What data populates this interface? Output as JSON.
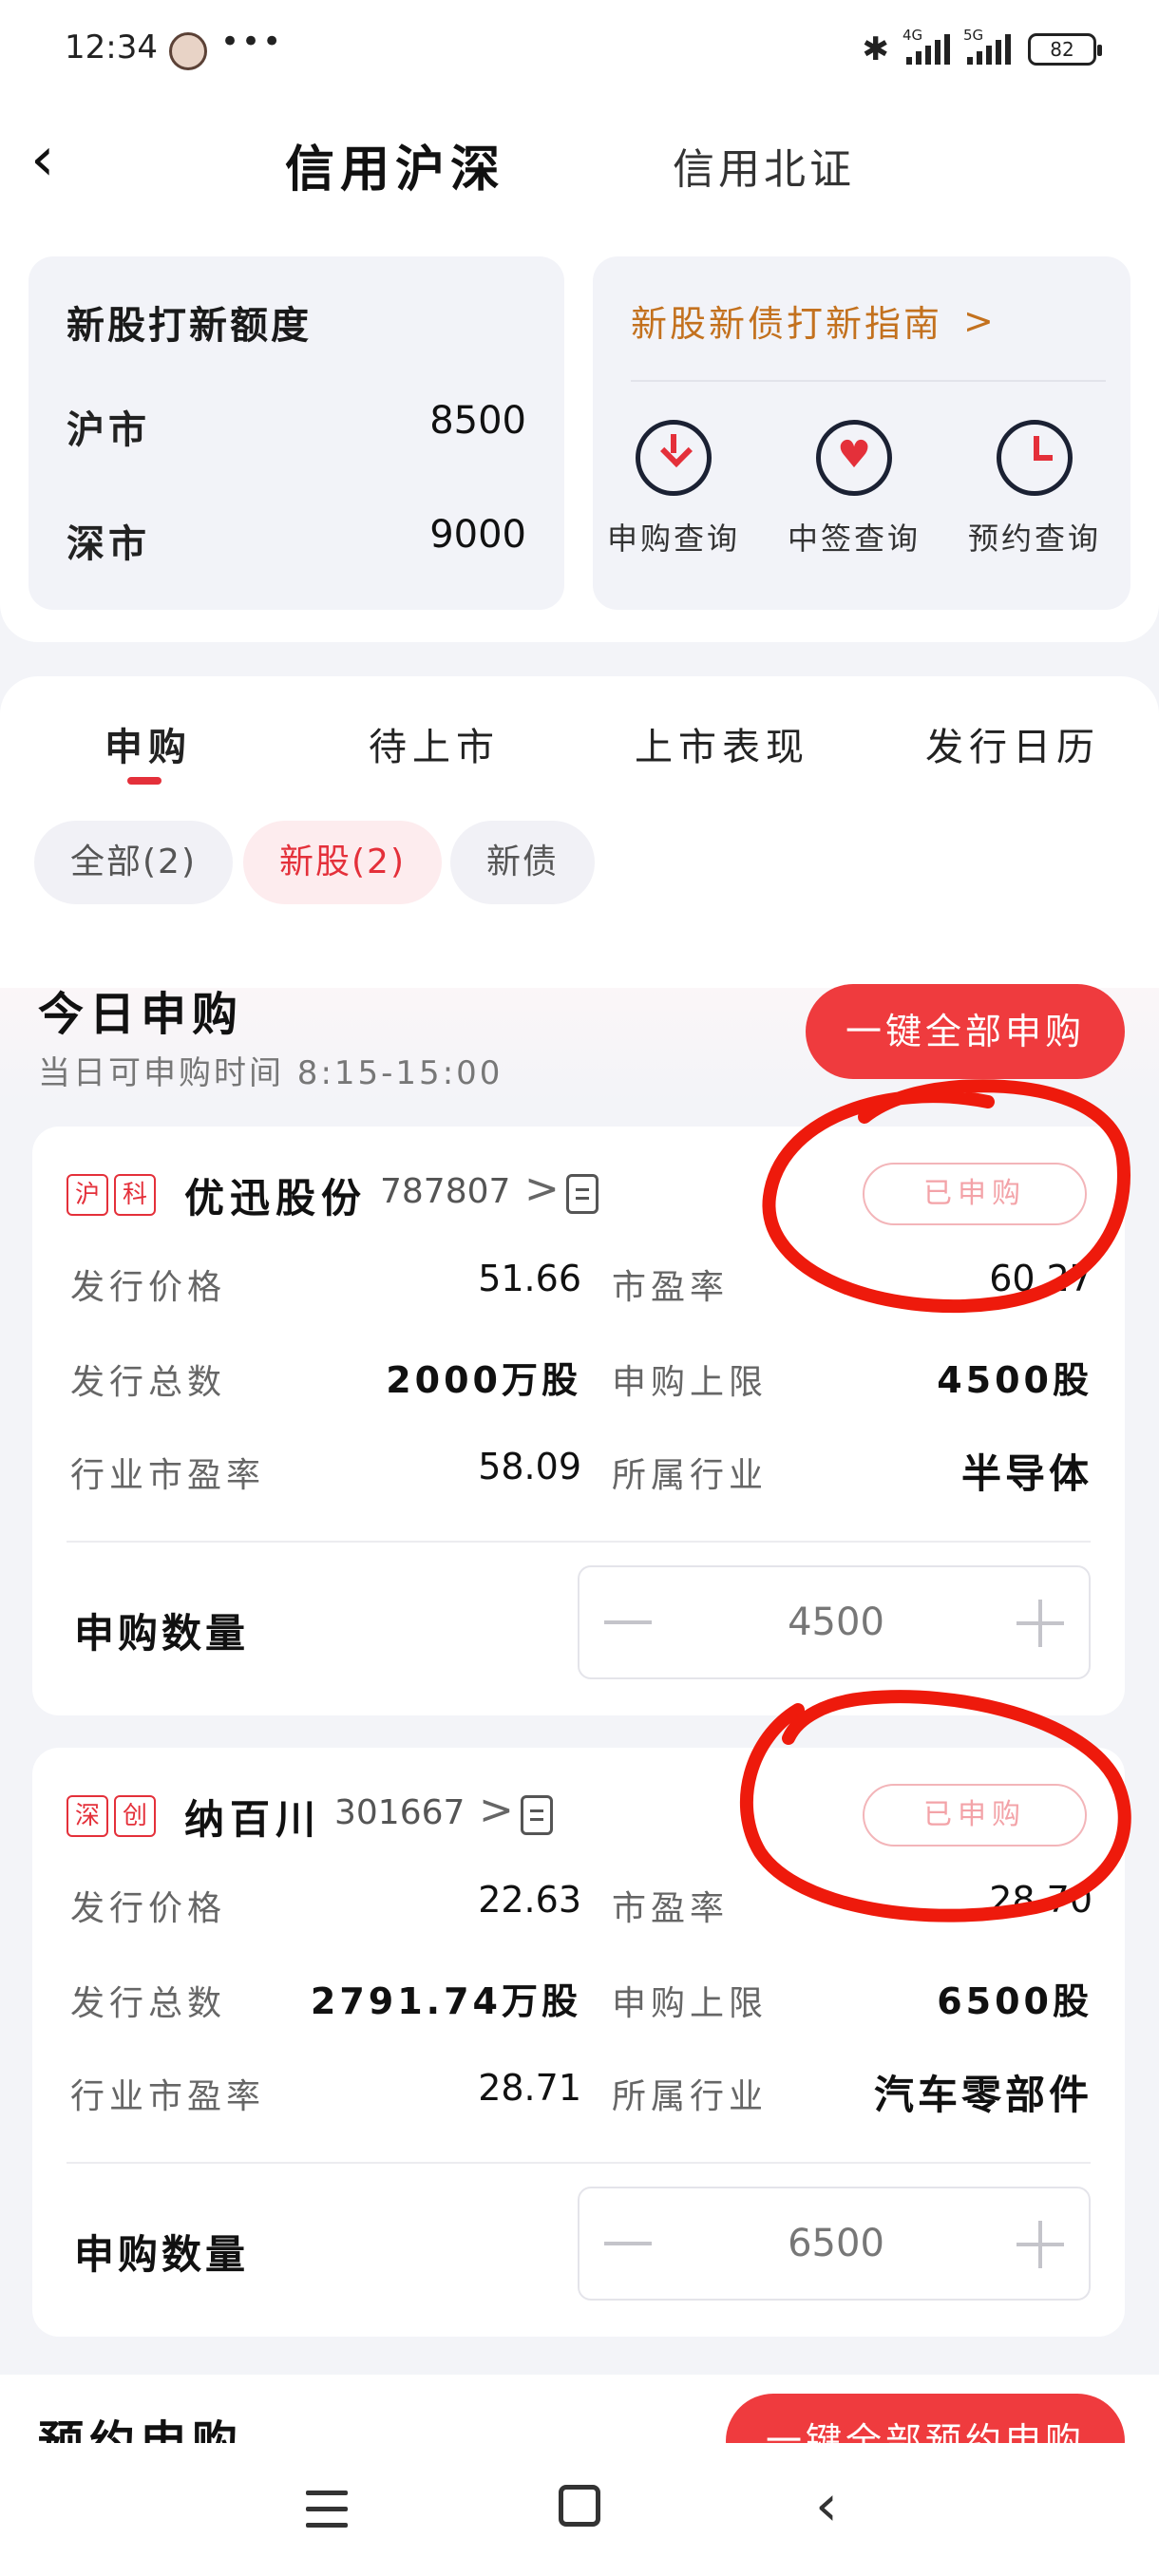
{
  "status_bar": {
    "time": "12:34",
    "dots": "•••",
    "net1": "4G",
    "net2": "5G",
    "battery": "82"
  },
  "header": {
    "tabs": [
      "信用沪深",
      "信用北证"
    ],
    "active_tab": "信用沪深"
  },
  "quota": {
    "title": "新股打新额度",
    "rows": [
      {
        "label": "沪市",
        "value": "8500"
      },
      {
        "label": "深市",
        "value": "9000"
      }
    ]
  },
  "guide": {
    "link_label": "新股新债打新指南",
    "chevron": ">",
    "actions": [
      {
        "label": "申购查询",
        "icon": "download-icon"
      },
      {
        "label": "中签查询",
        "icon": "heart-icon"
      },
      {
        "label": "预约查询",
        "icon": "clock-icon"
      }
    ]
  },
  "sub_tabs": [
    "申购",
    "待上市",
    "上市表现",
    "发行日历"
  ],
  "active_sub_tab": "申购",
  "filters": [
    "全部(2)",
    "新股(2)",
    "新债"
  ],
  "active_filter": "新股(2)",
  "today": {
    "title": "今日申购",
    "time_note": "当日可申购时间 8:15-15:00",
    "one_click_label": "一键全部申购"
  },
  "stocks": [
    {
      "markets": [
        "沪",
        "科"
      ],
      "name": "优迅股份",
      "code": "787807",
      "more": ">",
      "status": "已申购",
      "fields": [
        {
          "label": "发行价格",
          "value": "51.66"
        },
        {
          "label": "市盈率",
          "value": "60.27"
        },
        {
          "label": "发行总数",
          "value": "2000万股"
        },
        {
          "label": "申购上限",
          "value": "4500股"
        },
        {
          "label": "行业市盈率",
          "value": "58.09"
        },
        {
          "label": "所属行业",
          "value": "半导体"
        }
      ],
      "qty_label": "申购数量",
      "qty_value": "4500"
    },
    {
      "markets": [
        "深",
        "创"
      ],
      "name": "纳百川",
      "code": "301667",
      "more": ">",
      "status": "已申购",
      "fields": [
        {
          "label": "发行价格",
          "value": "22.63"
        },
        {
          "label": "市盈率",
          "value": "28.70"
        },
        {
          "label": "发行总数",
          "value": "2791.74万股"
        },
        {
          "label": "申购上限",
          "value": "6500股"
        },
        {
          "label": "行业市盈率",
          "value": "28.71"
        },
        {
          "label": "所属行业",
          "value": "汽车零部件"
        }
      ],
      "qty_label": "申购数量",
      "qty_value": "6500"
    }
  ],
  "reserve": {
    "title": "预约申购",
    "btn_label": "一键全部预约申购"
  },
  "colors": {
    "accent": "#ef3b3e",
    "guide": "#c3711e",
    "annotation": "#ee1a0c"
  }
}
